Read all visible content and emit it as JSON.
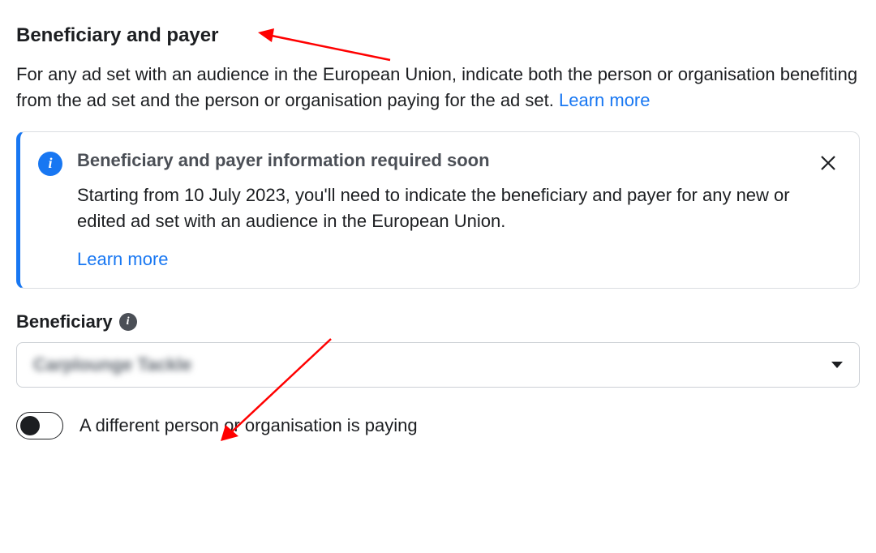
{
  "section": {
    "title": "Beneficiary and payer",
    "description": "For any ad set with an audience in the European Union, indicate both the person or organisation benefiting from the ad set and the person or organisation paying for the ad set. ",
    "learn_more": "Learn more"
  },
  "notice": {
    "title": "Beneficiary and payer information required soon",
    "body": "Starting from 10 July 2023, you'll need to indicate the beneficiary and payer for any new or edited ad set with an audience in the European Union.",
    "learn_more": "Learn more"
  },
  "beneficiary": {
    "label": "Beneficiary",
    "value": "Carplounge Tackle"
  },
  "toggle": {
    "label": "A different person or organisation is paying",
    "on": false
  },
  "colors": {
    "accent": "#1877f2"
  }
}
